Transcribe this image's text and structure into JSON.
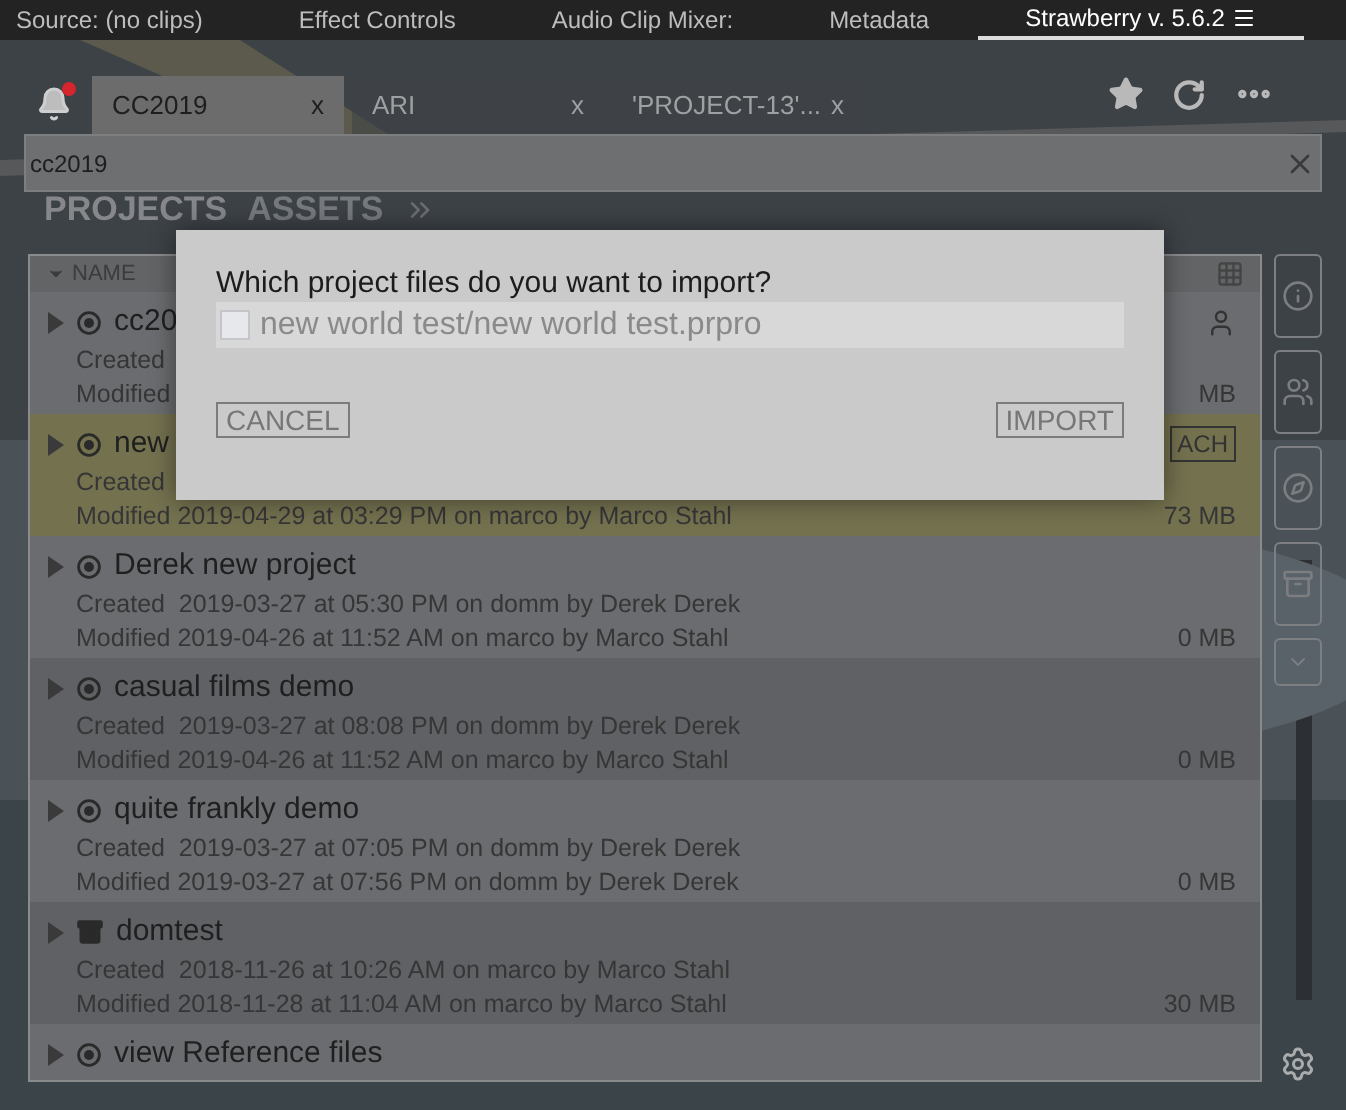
{
  "panel_tabs": [
    {
      "label": "Source: (no clips)",
      "selected": false
    },
    {
      "label": "Effect Controls",
      "selected": false
    },
    {
      "label": "Audio Clip Mixer:",
      "selected": false
    },
    {
      "label": "Metadata",
      "selected": false
    },
    {
      "label": "Strawberry v. 5.6.2",
      "selected": true
    }
  ],
  "notification": {
    "unread": true
  },
  "doc_tabs": [
    {
      "label": "CC2019",
      "close": "x",
      "selected": true
    },
    {
      "label": "ARI",
      "close": "x",
      "selected": false
    },
    {
      "label": "'PROJECT-13'...",
      "close": "x",
      "selected": false
    }
  ],
  "search": {
    "value": "cc2019"
  },
  "section_tabs": [
    {
      "label": "PROJECTS",
      "selected": true
    },
    {
      "label": "ASSETS",
      "selected": false
    }
  ],
  "list": {
    "column": "NAME",
    "rows": [
      {
        "kind": "project",
        "name": "cc20",
        "created": "Created",
        "modified": "Modified",
        "size": "MB",
        "highlighted": false
      },
      {
        "kind": "project",
        "name": "new",
        "created": "Created",
        "modified": "Modified 2019-04-29 at 03:29 PM on marco by Marco Stahl",
        "size": "73 MB",
        "action": "ACH",
        "highlighted": true
      },
      {
        "kind": "project",
        "name": "Derek new project",
        "created": "Created  2019-03-27 at 05:30 PM on domm by Derek Derek",
        "modified": "Modified 2019-04-26 at 11:52 AM on marco by Marco Stahl",
        "size": "0 MB",
        "highlighted": false
      },
      {
        "kind": "project",
        "name": "casual films demo",
        "created": "Created  2019-03-27 at 08:08 PM on domm by Derek Derek",
        "modified": "Modified 2019-04-26 at 11:52 AM on marco by Marco Stahl",
        "size": "0 MB",
        "highlighted": false
      },
      {
        "kind": "project",
        "name": "quite frankly demo",
        "created": "Created  2019-03-27 at 07:05 PM on domm by Derek Derek",
        "modified": "Modified 2019-03-27 at 07:56 PM on domm by Derek Derek",
        "size": "0 MB",
        "highlighted": false
      },
      {
        "kind": "archive",
        "name": "domtest",
        "created": "Created  2018-11-26 at 10:26 AM on marco by Marco Stahl",
        "modified": "Modified 2018-11-28 at 11:04 AM on marco by Marco Stahl",
        "size": "30 MB",
        "highlighted": false
      },
      {
        "kind": "project",
        "name": "view Reference files",
        "highlighted": false
      }
    ]
  },
  "dialog": {
    "title": "Which project files do you want to import?",
    "files": [
      {
        "label": "new world test/new world test.prpro",
        "checked": false
      }
    ],
    "buttons": [
      "CANCEL",
      "IMPORT"
    ]
  }
}
